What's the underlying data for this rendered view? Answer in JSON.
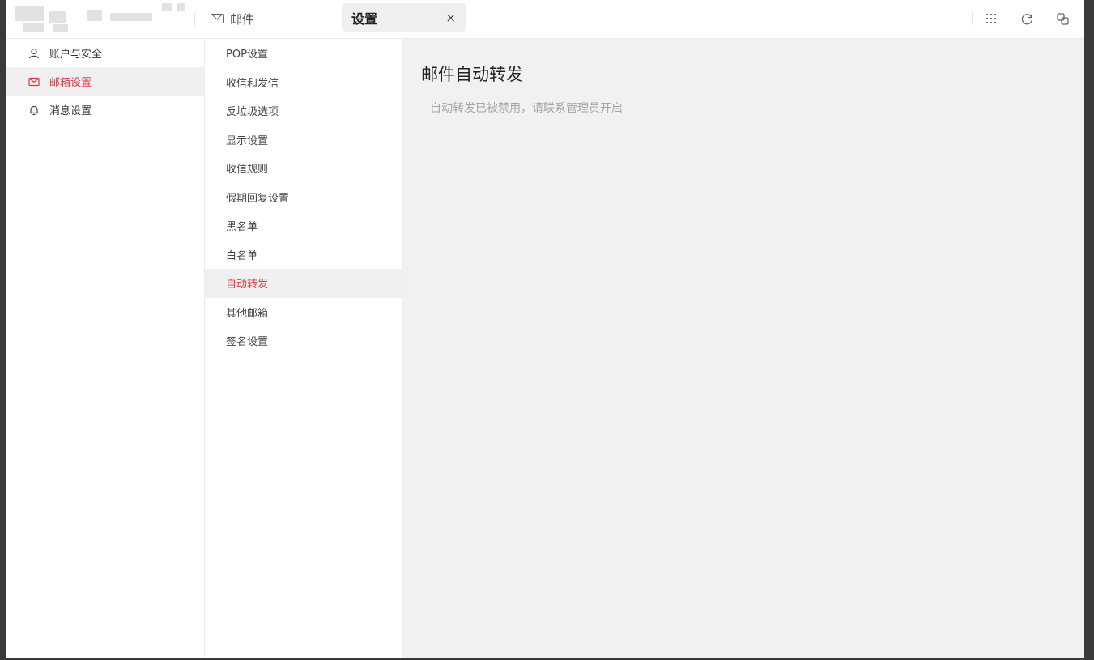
{
  "topbar": {
    "mail_tab_label": "邮件",
    "settings_tab_label": "设置",
    "close_symbol": "×"
  },
  "sidebar_main": {
    "items": [
      {
        "label": "账户与安全",
        "icon": "user-icon"
      },
      {
        "label": "邮箱设置",
        "icon": "mail-icon"
      },
      {
        "label": "消息设置",
        "icon": "bell-icon"
      }
    ]
  },
  "sidebar_sub": {
    "items": [
      {
        "label": "POP设置"
      },
      {
        "label": "收信和发信"
      },
      {
        "label": "反垃圾选项"
      },
      {
        "label": "显示设置"
      },
      {
        "label": "收信规则"
      },
      {
        "label": "假期回复设置"
      },
      {
        "label": "黑名单"
      },
      {
        "label": "白名单"
      },
      {
        "label": "自动转发"
      },
      {
        "label": "其他邮箱"
      },
      {
        "label": "签名设置"
      }
    ]
  },
  "content": {
    "title": "邮件自动转发",
    "note": "自动转发已被禁用，请联系管理员开启"
  },
  "colors": {
    "accent": "#e0373d",
    "content_bg": "#f1f1f4"
  }
}
